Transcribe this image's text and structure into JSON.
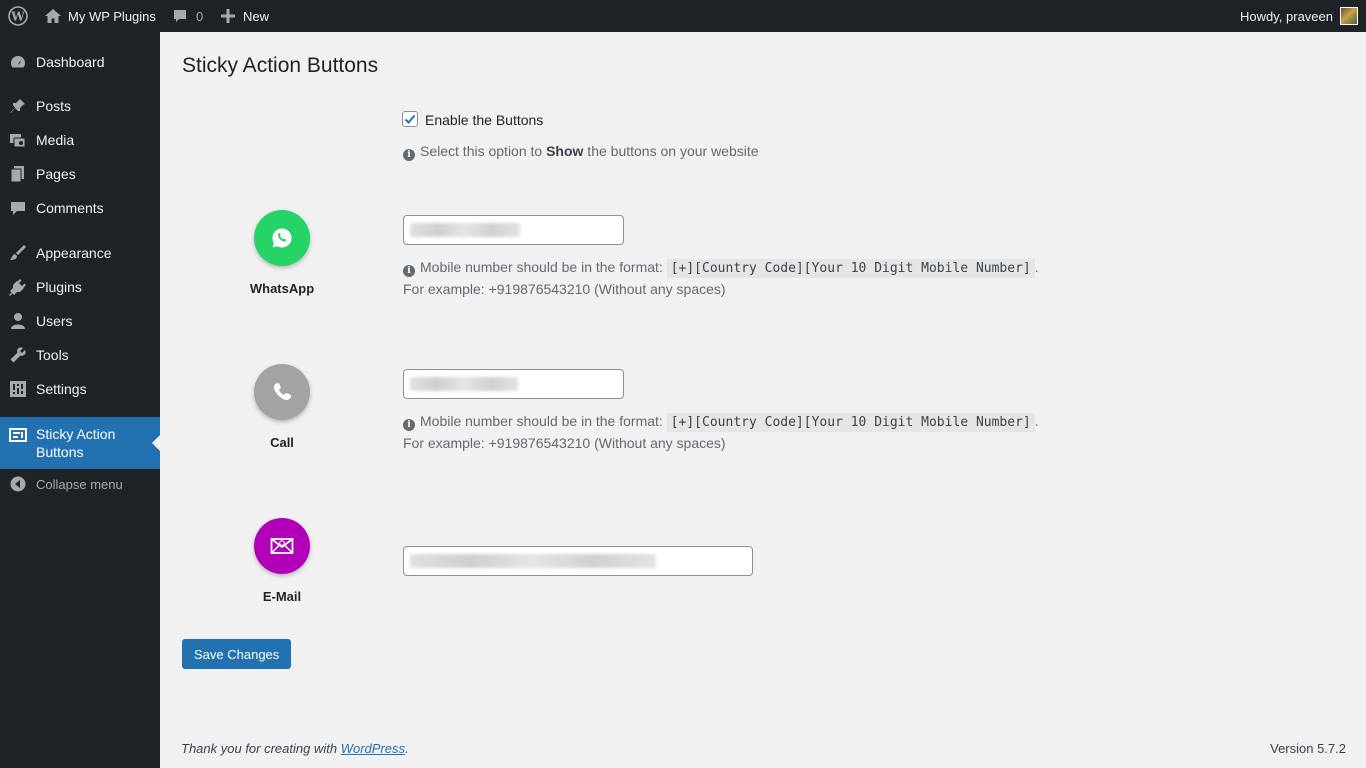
{
  "admin_bar": {
    "site_name": "My WP Plugins",
    "comments_count": "0",
    "new_label": "New",
    "greeting": "Howdy, praveen"
  },
  "sidebar": {
    "items": [
      {
        "label": "Dashboard",
        "icon": "dashboard-icon"
      },
      {
        "label": "Posts",
        "icon": "pin-icon"
      },
      {
        "label": "Media",
        "icon": "media-icon"
      },
      {
        "label": "Pages",
        "icon": "pages-icon"
      },
      {
        "label": "Comments",
        "icon": "comment-icon"
      },
      {
        "label": "Appearance",
        "icon": "brush-icon"
      },
      {
        "label": "Plugins",
        "icon": "plug-icon"
      },
      {
        "label": "Users",
        "icon": "user-icon"
      },
      {
        "label": "Tools",
        "icon": "wrench-icon"
      },
      {
        "label": "Settings",
        "icon": "settings-icon"
      },
      {
        "label_line1": "Sticky Action",
        "label_line2": "Buttons",
        "icon": "buttons-icon",
        "current": true
      }
    ],
    "collapse_label": "Collapse menu"
  },
  "page": {
    "title": "Sticky Action Buttons",
    "enable": {
      "label": "Enable the Buttons",
      "checked": true,
      "desc_prefix": "Select this option to ",
      "desc_bold": "Show",
      "desc_suffix": " the buttons on your website"
    },
    "whatsapp": {
      "label": "WhatsApp",
      "color": "#25d366",
      "desc_prefix": "Mobile number should be in the format: ",
      "format_code": "[+][Country Code][Your 10 Digit Mobile Number]",
      "desc_suffix": ".",
      "example": "For example: +919876543210 (Without any spaces)"
    },
    "call": {
      "label": "Call",
      "color": "#a3a3a3",
      "desc_prefix": "Mobile number should be in the format: ",
      "format_code": "[+][Country Code][Your 10 Digit Mobile Number]",
      "desc_suffix": ".",
      "example": "For example: +919876543210 (Without any spaces)"
    },
    "email": {
      "label": "E-Mail",
      "color": "#b100b7"
    },
    "save_label": "Save Changes"
  },
  "footer": {
    "thanks_prefix": "Thank you for creating with ",
    "thanks_link": "WordPress",
    "thanks_suffix": ".",
    "version": "Version 5.7.2"
  },
  "colors": {
    "admin_bg": "#1d2327",
    "accent": "#2271b1",
    "page_bg": "#f1f1f1"
  }
}
